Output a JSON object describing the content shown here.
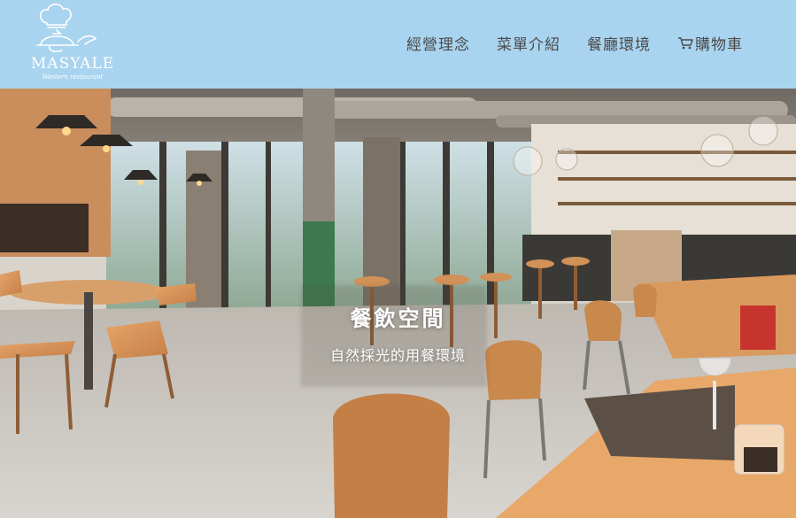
{
  "brand": {
    "name": "MASYALE",
    "tagline": "Western restaurant",
    "logo_icon": "chef-hat-cloche-icon"
  },
  "nav": {
    "items": [
      {
        "label": "經營理念"
      },
      {
        "label": "菜單介紹"
      },
      {
        "label": "餐廳環境"
      },
      {
        "label": "購物車",
        "icon": "cart-icon"
      }
    ]
  },
  "hero": {
    "title": "餐飲空間",
    "subtitle": "自然採光的用餐環境",
    "image": "restaurant-interior-photo"
  },
  "colors": {
    "header_bg": "#a9d4ef",
    "nav_text": "#4a4a4a",
    "hero_text": "#ffffff"
  }
}
